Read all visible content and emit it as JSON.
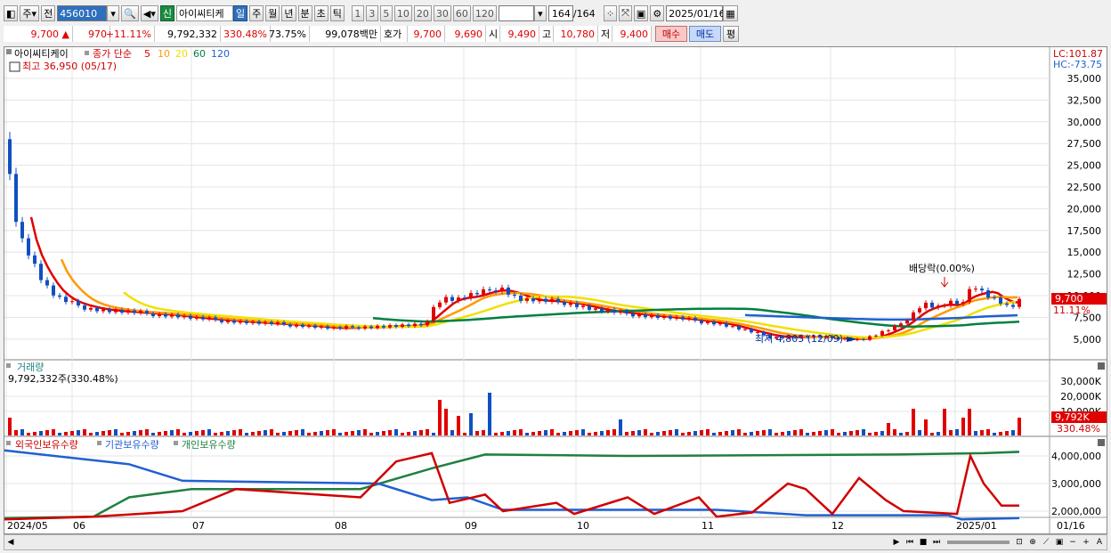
{
  "toolbar": {
    "mode1": "주",
    "mode2": "전",
    "code": "456010",
    "stock_name": "아이씨티케",
    "badge": "신",
    "periods": [
      "일",
      "주",
      "월",
      "년",
      "분",
      "초",
      "틱"
    ],
    "selected_period": "일",
    "intervals": [
      "1",
      "3",
      "5",
      "10",
      "20",
      "30",
      "60",
      "120"
    ],
    "count": "164",
    "count_total": "/164",
    "date": "2025/01/16"
  },
  "info": {
    "price": "9,700",
    "arrow": "▲",
    "change": "970",
    "change_pct": "+11.11%",
    "volume": "9,792,332",
    "vol_pct": "330.48%",
    "turnover": "73.75%",
    "amount": "99,078백만",
    "quote_label": "호가",
    "ask": "9,700",
    "bid": "9,690",
    "open_label": "시",
    "open": "9,490",
    "high_label": "고",
    "high": "10,780",
    "low_label": "저",
    "low": "9,400",
    "buy": "매수",
    "sell": "매도",
    "eval": "평"
  },
  "price_panel": {
    "name": "아이씨티케이",
    "legend_label": "종가 단순",
    "ma_periods": [
      "5",
      "10",
      "20",
      "60",
      "120"
    ],
    "ma_colors": [
      "#e00000",
      "#ff9900",
      "#f0e000",
      "#008040",
      "#2060d0"
    ],
    "high_text": "최고 36,950 (05/17)",
    "low_text": "최저 4,805 (12/09)",
    "dividend_text": "배당락(0.00%)",
    "lc": "LC:101.87",
    "hc": "HC:-73.75",
    "price_tag": "9,700",
    "pct_tag": "11.11%",
    "yticks": [
      "35,000",
      "32,500",
      "30,000",
      "27,500",
      "25,000",
      "22,500",
      "20,000",
      "17,500",
      "15,000",
      "12,500",
      "10,000",
      "7,500",
      "5,000"
    ]
  },
  "volume_panel": {
    "title": "거래량",
    "value_text": "9,792,332주(330.48%)",
    "yticks": [
      "30,000K",
      "20,000K",
      "10,000K"
    ],
    "tag": "9,792K",
    "pct_tag": "330.48%"
  },
  "holdings_panel": {
    "legend": [
      "외국인보유수량",
      "기관보유수량",
      "개인보유수량"
    ],
    "colors": [
      "#d00000",
      "#2060d0",
      "#208040"
    ],
    "yticks": [
      "4,000,000",
      "3,000,000",
      "2,000,000"
    ]
  },
  "xaxis": {
    "labels": [
      "2024/05",
      "06",
      "07",
      "08",
      "09",
      "10",
      "11",
      "12",
      "2025/01"
    ],
    "right_label": "01/16"
  }
}
